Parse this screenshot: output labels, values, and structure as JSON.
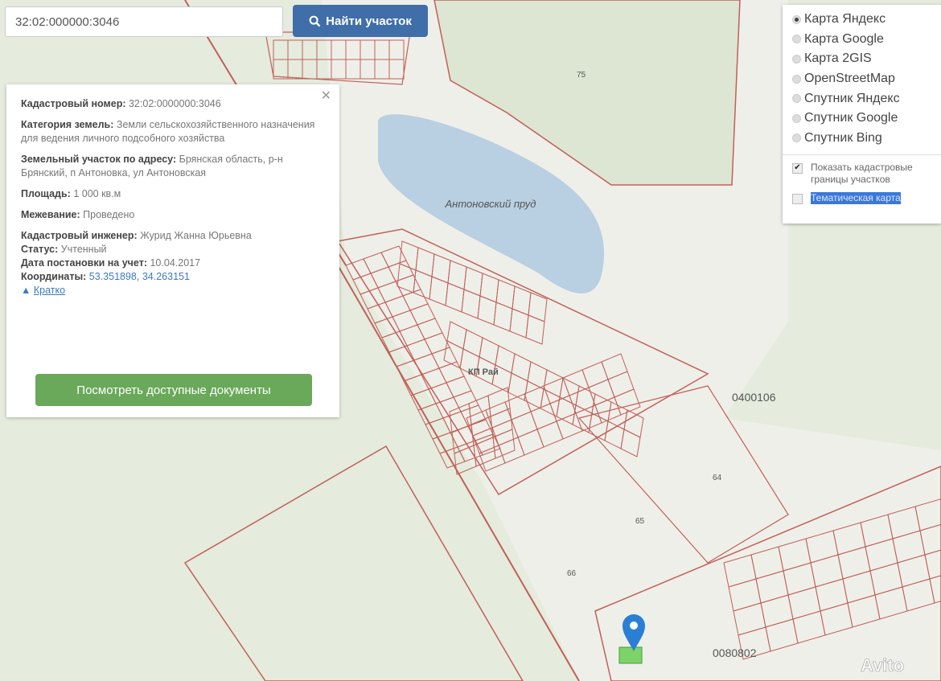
{
  "search": {
    "value": "32:02:000000:3046",
    "button_label": "Найти участок",
    "button_icon": "search-icon"
  },
  "popup": {
    "fields": [
      {
        "label": "Кадастровый номер:",
        "value": "32:02:0000000:3046"
      },
      {
        "label": "Категория земель:",
        "value": "Земли сельскохозяйственного назначения",
        "value2": "для ведения личного подсобного хозяйства"
      },
      {
        "label": "Земельный участок по адресу:",
        "value": "Брянская область, р-н Брянский, п Антоновка, ул Антоновская"
      },
      {
        "label": "Площадь:",
        "value": "1 000 кв.м"
      },
      {
        "label": "Межевание:",
        "value": "Проведено"
      },
      {
        "label": "Кадастровый инженер:",
        "value": "Журид Жанна Юрьевна"
      },
      {
        "label": "Статус:",
        "value": "Учтенный"
      },
      {
        "label": "Дата постановки на учет:",
        "value": "10.04.2017"
      },
      {
        "label": "Координаты:",
        "value": "53.351898, 34.263151"
      }
    ],
    "collapse_label": "Кратко",
    "docs_button": "Посмотреть доступные документы"
  },
  "layers": {
    "options": [
      "Карта Яндекс",
      "Карта Google",
      "Карта 2GIS",
      "OpenStreetMap",
      "Спутник Яндекс",
      "Спутник Google",
      "Спутник Bing"
    ],
    "selected": "Карта Яндекс",
    "checkboxes": [
      {
        "label": "Показать кадастровые границы участков",
        "checked": true
      },
      {
        "label": "Тематическая карта",
        "checked": false
      }
    ]
  },
  "map": {
    "lake_label": "Антоновский пруд",
    "labels": [
      "75",
      "0400106",
      "КП Рай",
      "64",
      "65",
      "66",
      "0080802"
    ],
    "watermark": "Avito",
    "colors": {
      "boundary": "#c0605a",
      "forest": "#dde6d2",
      "water": "#b9cfe2",
      "background": "#efefe9",
      "marker": "#2a7fd4",
      "selected_parcel": "#7bd36a"
    }
  }
}
